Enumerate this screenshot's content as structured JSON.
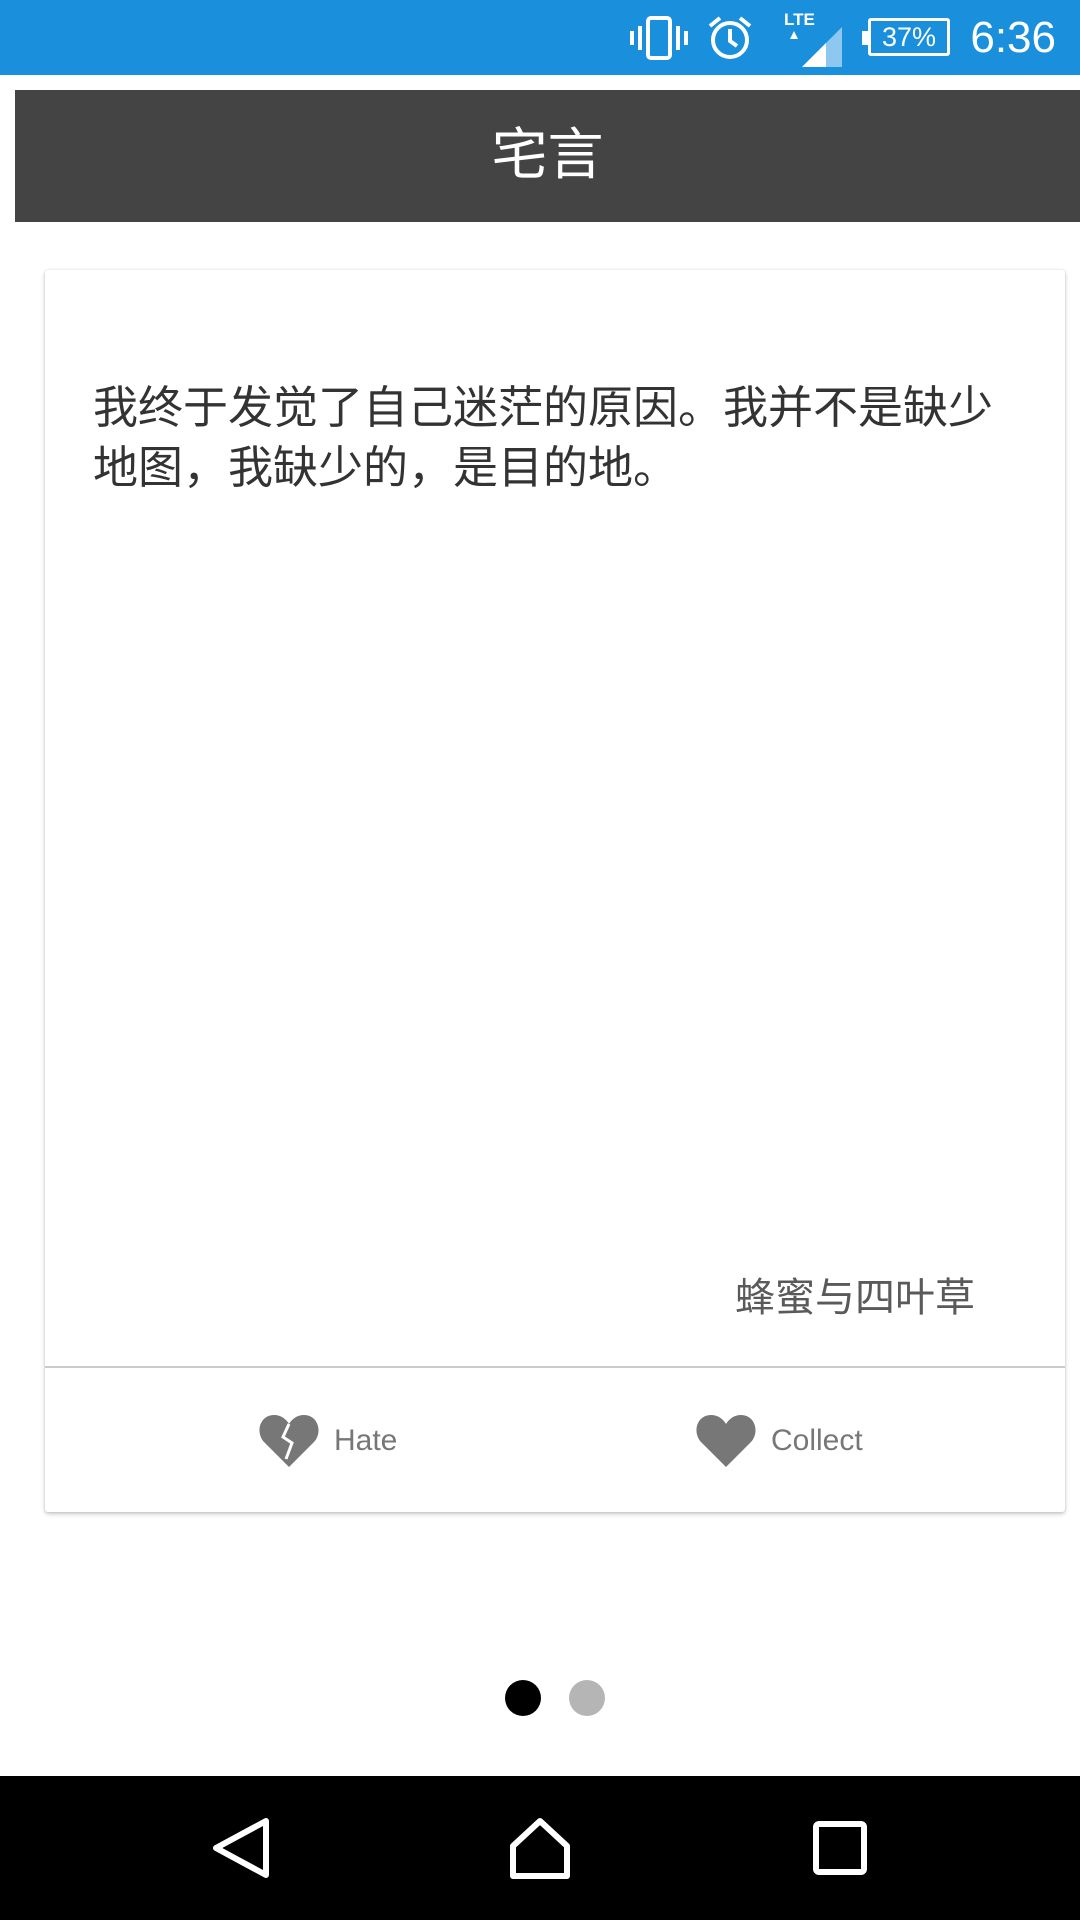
{
  "status_bar": {
    "time": "6:36",
    "battery": "37%",
    "network": "LTE",
    "icons": [
      "vibrate-icon",
      "alarm-icon",
      "signal-icon",
      "battery-icon"
    ],
    "background": "#1a8fdb"
  },
  "app_bar": {
    "title": "宅言",
    "background": "#444444"
  },
  "card": {
    "quote": "我终于发觉了自己迷茫的原因。我并不是缺少地图，我缺少的，是目的地。",
    "author": "蜂蜜与四叶草",
    "actions": {
      "hate_label": "Hate",
      "hate_icon": "broken-heart-icon",
      "collect_label": "Collect",
      "collect_icon": "heart-icon"
    }
  },
  "pager": {
    "pages": 2,
    "current": 1
  },
  "nav_bar": {
    "buttons": [
      "back-icon",
      "home-icon",
      "recents-icon"
    ]
  }
}
